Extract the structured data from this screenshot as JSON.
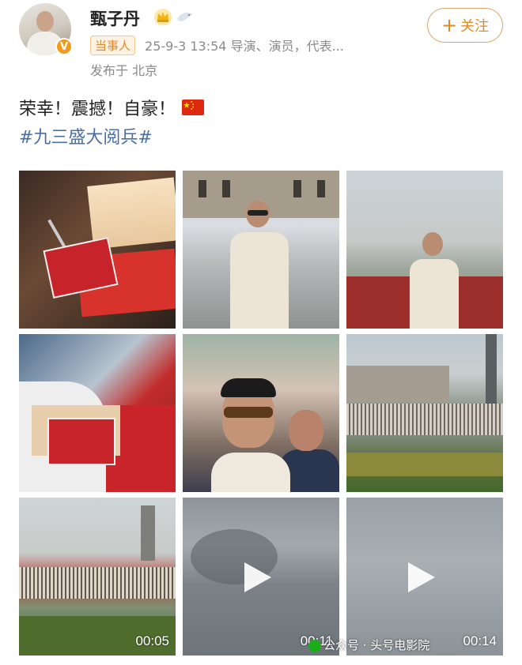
{
  "header": {
    "username": "甄子丹",
    "verified_badge": "V",
    "tag": "当事人",
    "meta_text": "25-9-3 13:54  导演、演员，代表...",
    "location": "发布于 北京",
    "follow_label": "关注",
    "follow_plus": "+"
  },
  "post": {
    "text": "荣幸！震撼！自豪！",
    "hashtag": "#九三盛大阅兵#"
  },
  "icons": {
    "crown": "crown-icon",
    "bird": "bird-icon",
    "flag": "china-flag-icon",
    "play": "play-icon"
  },
  "media": [
    {
      "kind": "photo",
      "subject": "invitation-cards"
    },
    {
      "kind": "photo",
      "subject": "standing-by-hall"
    },
    {
      "kind": "photo",
      "subject": "on-viewing-stand"
    },
    {
      "kind": "photo",
      "subject": "badge-in-hand"
    },
    {
      "kind": "photo",
      "subject": "selfie-in-crowd"
    },
    {
      "kind": "photo",
      "subject": "square-view"
    },
    {
      "kind": "video",
      "duration": "00:05"
    },
    {
      "kind": "video",
      "duration": "00:11"
    },
    {
      "kind": "video",
      "duration": "00:14"
    }
  ],
  "watermark": "公众号 · 头号电影院",
  "colors": {
    "accent": "#e08a26",
    "hashtag": "#4a6fa0",
    "meta": "#8a8a8a"
  }
}
